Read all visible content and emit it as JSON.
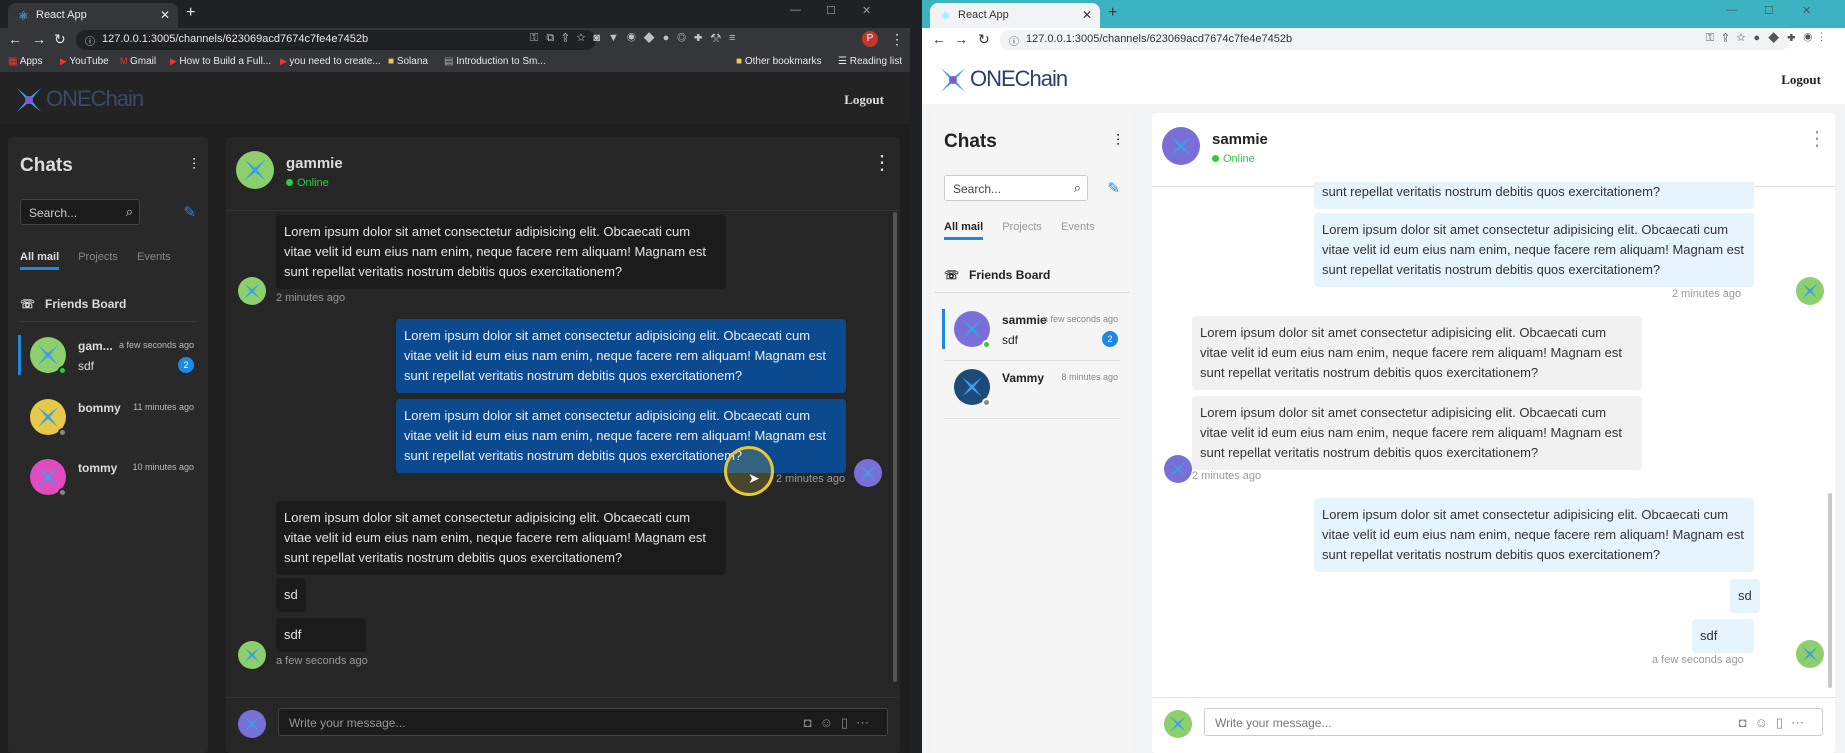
{
  "left": {
    "tab_title": "React App",
    "url": "127.0.0.1:3005/channels/623069acd7674c7fe4e7452b",
    "bookmarks": [
      "Apps",
      "YouTube",
      "Gmail",
      "How to Build a Full...",
      "you need to create...",
      "Solana",
      "Introduction to Sm...",
      "Other bookmarks",
      "Reading list"
    ],
    "logo_text": "ONEChain",
    "logout": "Logout",
    "sidebar": {
      "title": "Chats",
      "search_placeholder": "Search...",
      "tabs": [
        "All mail",
        "Projects",
        "Events"
      ],
      "board": "Friends Board",
      "chats": [
        {
          "name": "gam...",
          "time": "a few seconds ago",
          "msg": "sdf",
          "badge": "2"
        },
        {
          "name": "bommy",
          "time": "11 minutes ago",
          "msg": "",
          "badge": ""
        },
        {
          "name": "tommy",
          "time": "10 minutes ago",
          "msg": "",
          "badge": ""
        }
      ]
    },
    "conversation": {
      "name": "gammie",
      "status": "Online",
      "lorem": "Lorem ipsum dolor sit amet consectetur adipisicing elit. Obcaecati cum vitae velit id eum eius nam enim, neque facere rem aliquam! Magnam est sunt repellat veritatis nostrum debitis quos exercitationem?",
      "ts1": "2 minutes ago",
      "ts2": "2 minutes ago",
      "ts3": "a few seconds ago",
      "sd": "sd",
      "sdf": "sdf",
      "composer_placeholder": "Write your message..."
    }
  },
  "right": {
    "tab_title": "React App",
    "url": "127.0.0.1:3005/channels/623069acd7674c7fe4e7452b",
    "logo_text": "ONEChain",
    "logout": "Logout",
    "sidebar": {
      "title": "Chats",
      "search_placeholder": "Search...",
      "tabs": [
        "All mail",
        "Projects",
        "Events"
      ],
      "board": "Friends Board",
      "chats": [
        {
          "name": "sammie",
          "time": "a few seconds ago",
          "msg": "sdf",
          "badge": "2"
        },
        {
          "name": "Vammy",
          "time": "8 minutes ago",
          "msg": "",
          "badge": ""
        }
      ]
    },
    "conversation": {
      "name": "sammie",
      "status": "Online",
      "partial": "sunt repellat veritatis nostrum debitis quos exercitationem?",
      "lorem": "Lorem ipsum dolor sit amet consectetur adipisicing elit. Obcaecati cum vitae velit id eum eius nam enim, neque facere rem aliquam! Magnam est sunt repellat veritatis nostrum debitis quos exercitationem?",
      "ts1": "2 minutes ago",
      "ts2": "2 minutes ago",
      "ts3": "a few seconds ago",
      "sd": "sd",
      "sdf": "sdf",
      "composer_placeholder": "Write your message..."
    }
  },
  "colors": {
    "accent": "#1e88e5",
    "online": "#2ecc40",
    "outgoing_dark": "#0b4a8e",
    "outgoing_light": "#e6f4fd"
  },
  "icons": [
    "react-icon",
    "close-icon",
    "plus-icon",
    "back-icon",
    "forward-icon",
    "reload-icon",
    "lock-icon",
    "search-icon",
    "edit-icon",
    "filter-icon",
    "phone-icon",
    "kebab-icon",
    "camera-icon",
    "emoji-icon",
    "attach-icon",
    "more-icon"
  ]
}
